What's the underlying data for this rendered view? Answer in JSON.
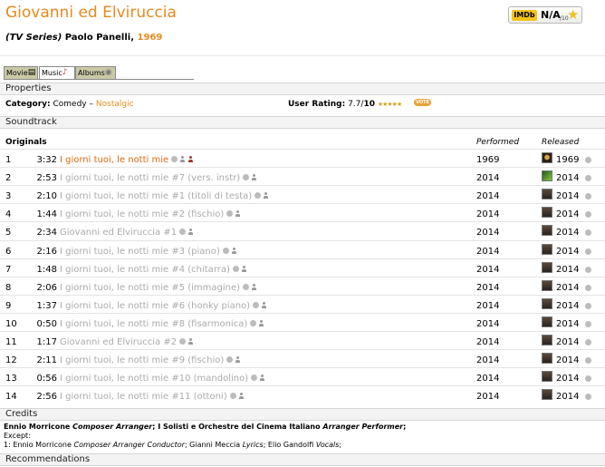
{
  "header": {
    "title": "Giovanni ed Elviruccia",
    "kind": "(TV Series)",
    "director": "Paolo Panelli,",
    "year": "1969",
    "imdb": {
      "logo": "IMDb",
      "score": "N/A",
      "outof": "/10",
      "icon": "star-icon"
    }
  },
  "tabs": [
    {
      "label": "Movie",
      "icon": "film-icon"
    },
    {
      "label": "Music",
      "icon": "music-note-icon"
    },
    {
      "label": "Albums",
      "icon": "disc-icon"
    }
  ],
  "sections": {
    "properties": "Properties",
    "soundtrack": "Soundtrack",
    "credits": "Credits",
    "recommendations": "Recommendations"
  },
  "properties": {
    "category_label": "Category:",
    "category_value": "Comedy",
    "category_sep": "–",
    "category_link": "Nostalgic",
    "rating_label": "User Rating:",
    "rating_value": "7.7",
    "rating_sep": "/",
    "rating_max": "10",
    "rating_stars": "★★★★★",
    "vote_label": "VOTE"
  },
  "table": {
    "originals": "Originals",
    "performed": "Performed",
    "released": "Released",
    "tracks": [
      {
        "num": "1",
        "dur": "3:32",
        "title": "I giorni tuoi, le notti mie",
        "performed": "1969",
        "released": "1969"
      },
      {
        "num": "2",
        "dur": "2:53",
        "title": "I giorni tuoi, le notti mie #7 (vers. instr)",
        "performed": "2014",
        "released": "2014"
      },
      {
        "num": "3",
        "dur": "2:10",
        "title": "I giorni tuoi, le notti mie #1 (titoli di testa)",
        "performed": "2014",
        "released": "2014"
      },
      {
        "num": "4",
        "dur": "1:44",
        "title": "I giorni tuoi, le notti mie #2 (fischio)",
        "performed": "2014",
        "released": "2014"
      },
      {
        "num": "5",
        "dur": "2:34",
        "title": "Giovanni ed Elviruccia #1",
        "performed": "2014",
        "released": "2014"
      },
      {
        "num": "6",
        "dur": "2:16",
        "title": "I giorni tuoi, le notti mie #3 (piano)",
        "performed": "2014",
        "released": "2014"
      },
      {
        "num": "7",
        "dur": "1:48",
        "title": "I giorni tuoi, le notti mie #4 (chitarra)",
        "performed": "2014",
        "released": "2014"
      },
      {
        "num": "8",
        "dur": "2:06",
        "title": "I giorni tuoi, le notti mie #5 (immagine)",
        "performed": "2014",
        "released": "2014"
      },
      {
        "num": "9",
        "dur": "1:37",
        "title": "I giorni tuoi, le notti mie #6 (honky piano)",
        "performed": "2014",
        "released": "2014"
      },
      {
        "num": "10",
        "dur": "0:50",
        "title": "I giorni tuoi, le notti mie #8 (fisarmonica)",
        "performed": "2014",
        "released": "2014"
      },
      {
        "num": "11",
        "dur": "1:17",
        "title": "Giovanni ed Elviruccia #2",
        "performed": "2014",
        "released": "2014"
      },
      {
        "num": "12",
        "dur": "2:11",
        "title": "I giorni tuoi, le notti mie #9 (fischio)",
        "performed": "2014",
        "released": "2014"
      },
      {
        "num": "13",
        "dur": "0:56",
        "title": "I giorni tuoi, le notti mie #10 (mandolino)",
        "performed": "2014",
        "released": "2014"
      },
      {
        "num": "14",
        "dur": "2:56",
        "title": "I giorni tuoi, le notti mie #11 (ottoni)",
        "performed": "2014",
        "released": "2014"
      }
    ]
  },
  "credits": {
    "line1_a": "Ennio Morricone",
    "line1_a_role": "Composer Arranger",
    "line1_b": "; I Solisti e Orchestre del Cinema Italiano",
    "line1_b_role": "Arranger Performer",
    "line1_end": ";",
    "except": "Except:",
    "line3_prefix": "1: Ennio Morricone",
    "line3_role1": "Composer Arranger Conductor",
    "line3_mid1": "; Gianni Meccia",
    "line3_role2": "Lyrics",
    "line3_mid2": "; Elio Gandolfi",
    "line3_role3": "Vocals",
    "line3_end": ";"
  },
  "colors": {
    "accent": "#e88a1e",
    "dim_title": "#ababab",
    "first_title": "#e06a10",
    "section_bg": "#f3f3f3"
  }
}
